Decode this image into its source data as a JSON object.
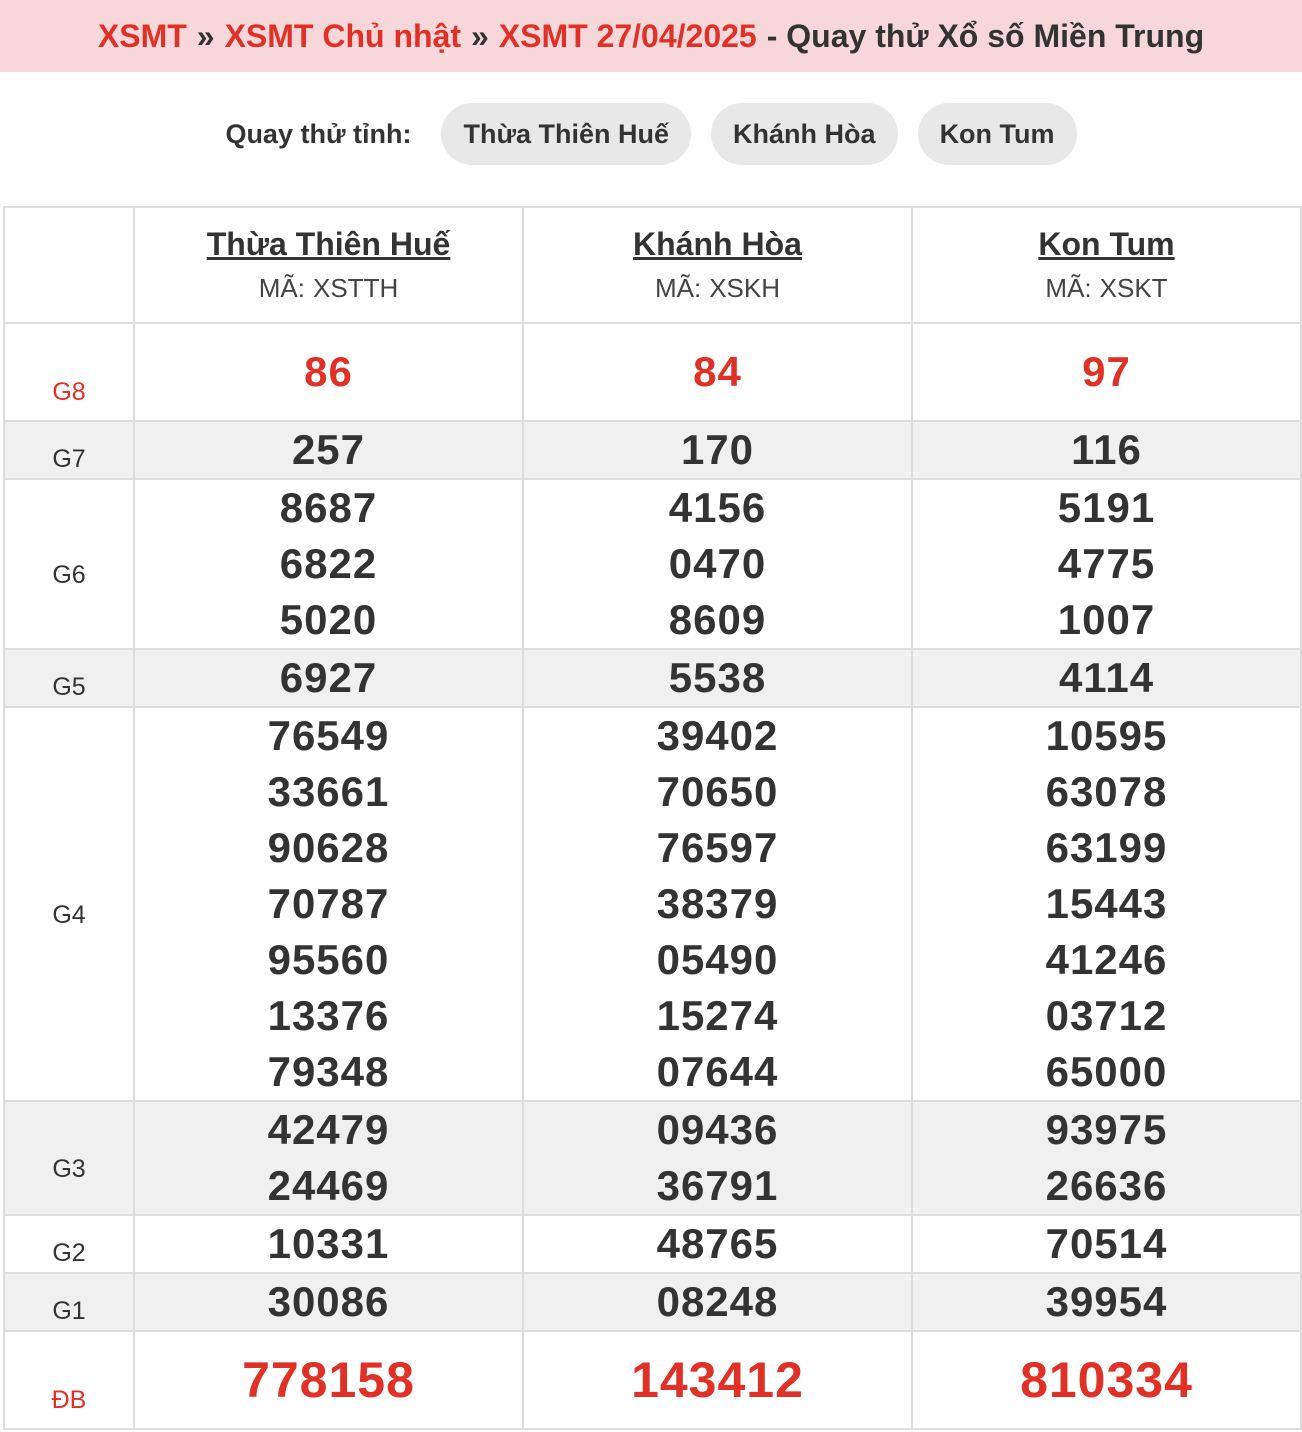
{
  "breadcrumb": {
    "home": "XSMT",
    "day": "XSMT Chủ nhật",
    "date": "XSMT 27/04/2025",
    "separator": "»",
    "tail": "- Quay thử Xổ số Miền Trung"
  },
  "province_filter": {
    "label": "Quay thử tỉnh:",
    "chips": [
      "Thừa Thiên Huế",
      "Khánh Hòa",
      "Kon Tum"
    ]
  },
  "colors": {
    "accent_red": "#e03127",
    "header_bg": "#f8d7da",
    "chip_bg": "#e8e8e8",
    "row_shade": "#f0f0f0"
  },
  "table": {
    "code_label": "MÃ:",
    "provinces": [
      {
        "name": "Thừa Thiên Huế",
        "code": "XSTTH"
      },
      {
        "name": "Khánh Hòa",
        "code": "XSKH"
      },
      {
        "name": "Kon Tum",
        "code": "XSKT"
      }
    ],
    "prizes": [
      {
        "label": "G8",
        "values": [
          [
            "86"
          ],
          [
            "84"
          ],
          [
            "97"
          ]
        ]
      },
      {
        "label": "G7",
        "values": [
          [
            "257"
          ],
          [
            "170"
          ],
          [
            "116"
          ]
        ]
      },
      {
        "label": "G6",
        "values": [
          [
            "8687",
            "6822",
            "5020"
          ],
          [
            "4156",
            "0470",
            "8609"
          ],
          [
            "5191",
            "4775",
            "1007"
          ]
        ]
      },
      {
        "label": "G5",
        "values": [
          [
            "6927"
          ],
          [
            "5538"
          ],
          [
            "4114"
          ]
        ]
      },
      {
        "label": "G4",
        "values": [
          [
            "76549",
            "33661",
            "90628",
            "70787",
            "95560",
            "13376",
            "79348"
          ],
          [
            "39402",
            "70650",
            "76597",
            "38379",
            "05490",
            "15274",
            "07644"
          ],
          [
            "10595",
            "63078",
            "63199",
            "15443",
            "41246",
            "03712",
            "65000"
          ]
        ]
      },
      {
        "label": "G3",
        "values": [
          [
            "42479",
            "24469"
          ],
          [
            "09436",
            "36791"
          ],
          [
            "93975",
            "26636"
          ]
        ]
      },
      {
        "label": "G2",
        "values": [
          [
            "10331"
          ],
          [
            "48765"
          ],
          [
            "70514"
          ]
        ]
      },
      {
        "label": "G1",
        "values": [
          [
            "30086"
          ],
          [
            "08248"
          ],
          [
            "39954"
          ]
        ]
      },
      {
        "label": "ĐB",
        "values": [
          [
            "778158"
          ],
          [
            "143412"
          ],
          [
            "810334"
          ]
        ]
      }
    ]
  }
}
